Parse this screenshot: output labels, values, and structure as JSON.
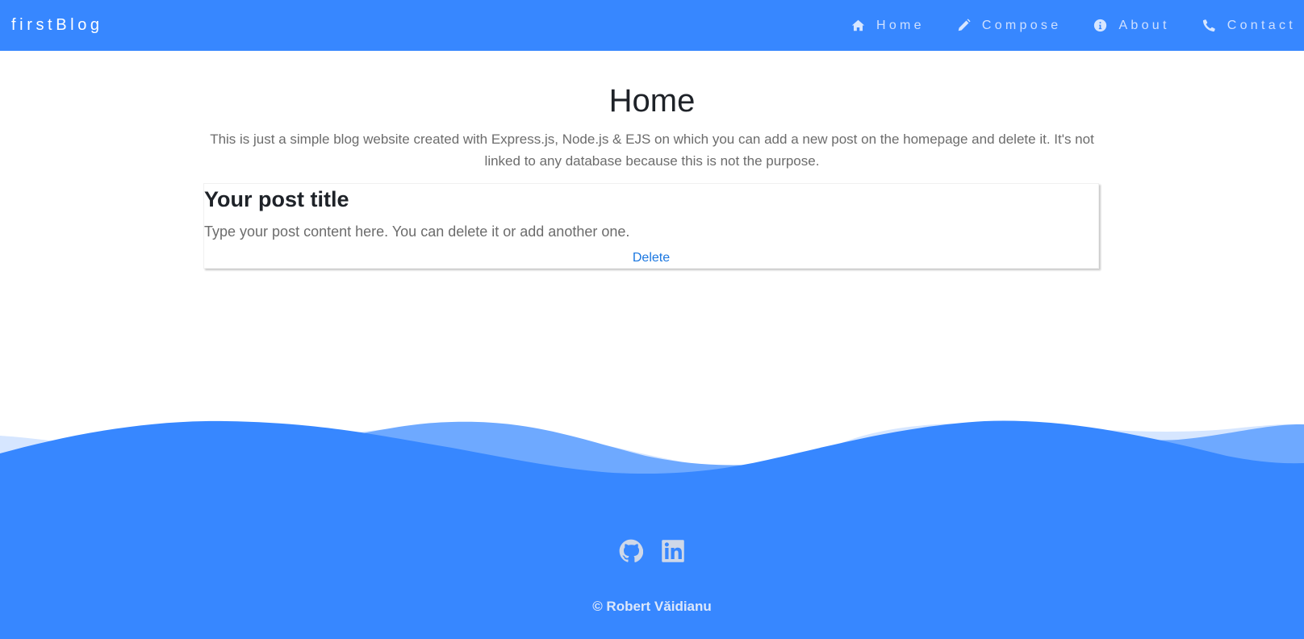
{
  "navbar": {
    "brand": "firstBlog",
    "links": [
      {
        "label": "Home",
        "icon": "home-icon"
      },
      {
        "label": "Compose",
        "icon": "pencil-icon"
      },
      {
        "label": "About",
        "icon": "info-icon"
      },
      {
        "label": "Contact",
        "icon": "phone-icon"
      }
    ]
  },
  "main": {
    "title": "Home",
    "intro": "This is just a simple blog website created with Express.js, Node.js & EJS on which you can add a new post on the homepage and delete it. It's not linked to any database because this is not the purpose.",
    "posts": [
      {
        "title": "Your post title",
        "content": "Type your post content here. You can delete it or add another one.",
        "delete_label": "Delete"
      }
    ]
  },
  "footer": {
    "social": [
      {
        "icon": "github-icon"
      },
      {
        "icon": "linkedin-icon"
      }
    ],
    "copyright": "© Robert Văidianu"
  },
  "colors": {
    "primary": "#3787ff",
    "wave_light": "#d6e6ff",
    "wave_mid": "#6ea9ff",
    "text_muted": "#6c6c6c",
    "link": "#1b77e0"
  }
}
